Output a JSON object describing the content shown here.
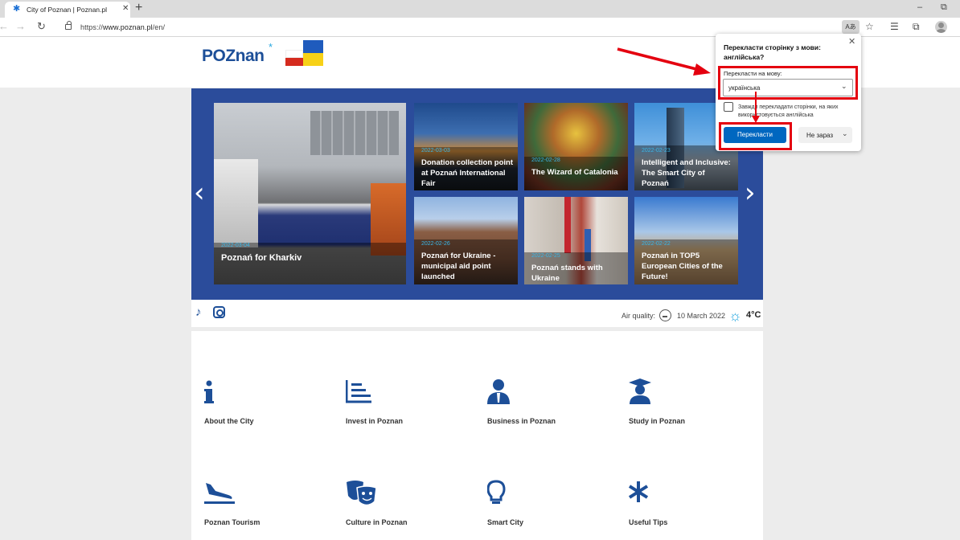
{
  "browser": {
    "tab_title": "City of Poznan | Poznan.pl",
    "tab_close": "✕",
    "new_tab": "+",
    "window_minimize": "–",
    "window_maximize": "⧉",
    "url_prefix": "https://",
    "url_host": "www.poznan.pl",
    "url_path": "/en/",
    "translate_icon_text": "Aあ",
    "icons": [
      "back-icon",
      "forward-icon",
      "refresh-icon",
      "lock-icon",
      "translate-icon",
      "favorite-add-icon",
      "favorites-icon",
      "collections-icon",
      "profile-icon"
    ]
  },
  "site": {
    "logo_text": "POZnan",
    "logo_star": "*"
  },
  "slider": {
    "prev": "‹",
    "next": "›",
    "cards": [
      {
        "date": "2022-03-04",
        "title": "Poznań for Kharkiv"
      },
      {
        "date": "2022-03-03",
        "title": "Donation collection point at Poznań International Fair"
      },
      {
        "date": "2022-02-28",
        "title": "The Wizard of Catalonia"
      },
      {
        "date": "2022-02-23",
        "title": "Intelligent and Inclusive: The Smart City of Poznań"
      },
      {
        "date": "2022-02-26",
        "title": "Poznań for Ukraine - municipal aid point launched"
      },
      {
        "date": "2022-02-25",
        "title": "Poznań stands with Ukraine"
      },
      {
        "date": "2022-02-22",
        "title": "Poznań in TOP5 European Cities of the Future!"
      }
    ]
  },
  "social": {
    "tiktok_glyph": "♪",
    "air_quality_label": "Air quality:",
    "date": "10 March 2022",
    "temperature": "4°C"
  },
  "quick_links": [
    {
      "label": "About the City",
      "icon": "info-icon"
    },
    {
      "label": "Invest in Poznan",
      "icon": "chart-icon"
    },
    {
      "label": "Business in Poznan",
      "icon": "business-person-icon"
    },
    {
      "label": "Study in Poznan",
      "icon": "graduate-icon"
    },
    {
      "label": "Poznan Tourism",
      "icon": "plane-landing-icon"
    },
    {
      "label": "Culture in Poznan",
      "icon": "theater-masks-icon"
    },
    {
      "label": "Smart City",
      "icon": "lightbulb-icon"
    },
    {
      "label": "Useful Tips",
      "icon": "asterisk-icon"
    }
  ],
  "translate_popup": {
    "title": "Перекласти сторінку з мови: англійська?",
    "close": "✕",
    "to_language_label": "Перекласти на мову:",
    "selected_language": "українська",
    "always_translate": "Завжди перекладати сторінки, на яких використовується англійська",
    "translate_button": "Перекласти",
    "not_now_button": "Не зараз"
  },
  "colors": {
    "brand_blue": "#1d4f98",
    "slider_bg": "#2b4c9b",
    "accent_cyan": "#39b7e8",
    "highlight_red": "#e4000f",
    "primary_button": "#0067c0"
  }
}
